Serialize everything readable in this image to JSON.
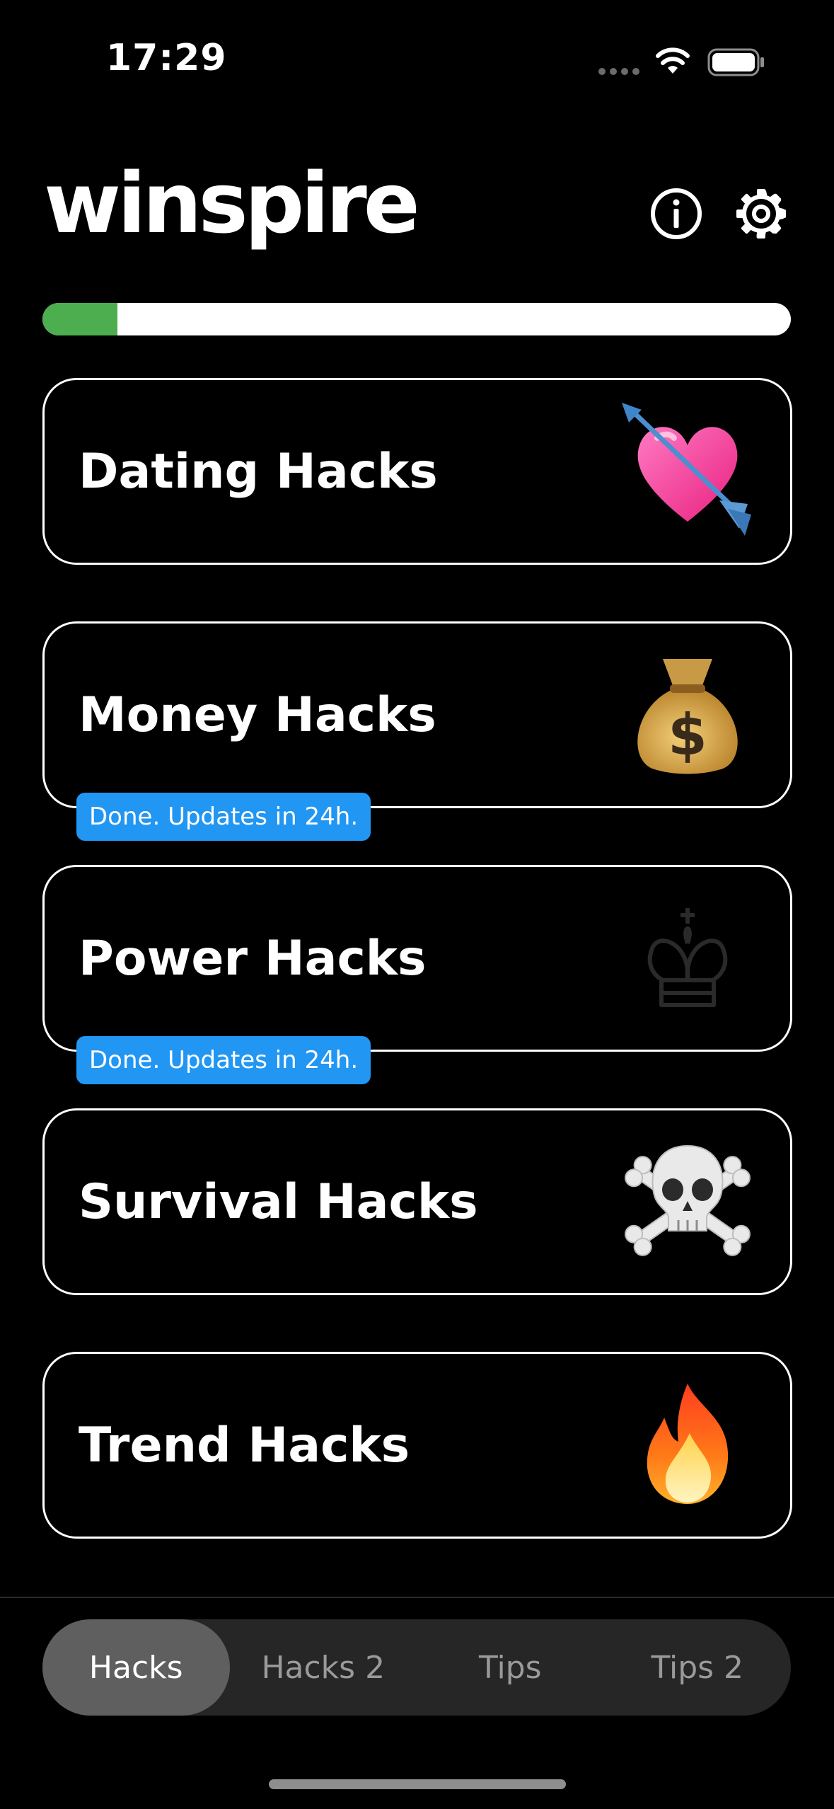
{
  "status_bar": {
    "time": "17:29"
  },
  "header": {
    "logo": "winspire",
    "info_icon": "info-icon",
    "settings_icon": "gear-icon"
  },
  "progress": {
    "value_fraction": 0.1,
    "fill_color": "#4cae4f",
    "track_color": "#ffffff"
  },
  "cards": [
    {
      "title": "Dating Hacks",
      "icon": "heart-with-arrow-icon"
    },
    {
      "title": "Money Hacks",
      "icon": "money-bag-icon",
      "badge": "Done. Updates in 24h."
    },
    {
      "title": "Power Hacks",
      "icon": "chess-king-icon",
      "badge": "Done. Updates in 24h."
    },
    {
      "title": "Survival Hacks",
      "icon": "skull-crossbones-icon"
    },
    {
      "title": "Trend Hacks",
      "icon": "fire-icon"
    }
  ],
  "tabs": [
    {
      "label": "Hacks",
      "active": true
    },
    {
      "label": "Hacks 2",
      "active": false
    },
    {
      "label": "Tips",
      "active": false
    },
    {
      "label": "Tips 2",
      "active": false
    }
  ],
  "colors": {
    "background": "#000000",
    "badge": "#2196f3",
    "tab_active": "#5f5f5f",
    "tab_bar": "#262626"
  }
}
